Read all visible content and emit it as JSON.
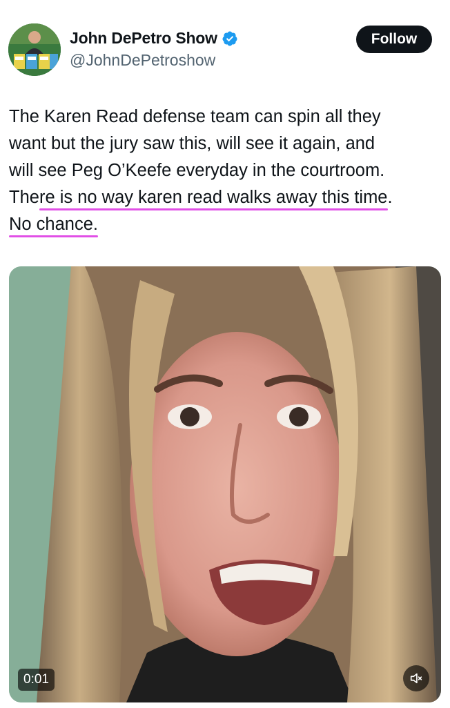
{
  "author": {
    "display_name": "John DePetro Show",
    "handle": "@JohnDePetroshow",
    "verified_icon": "verified-badge-icon",
    "avatar_icon": "avatar"
  },
  "follow_button": {
    "label": "Follow"
  },
  "tweet": {
    "line1": "The Karen Read defense team can spin all they",
    "line2": "want but the jury saw this, will see it again, and",
    "line3": "will see Peg O’Keefe everyday in the courtroom.",
    "line4_pre": "The",
    "line4_highlight": "re is no way karen read walks away this time",
    "line4_post": ".",
    "line5_highlight": "No chance."
  },
  "video": {
    "timestamp": "0:01",
    "mute_icon": "muted-speaker-icon"
  },
  "colors": {
    "accent_blue": "#1d9bf0",
    "highlight_underline": "#e14fe6",
    "follow_bg": "#0f1419",
    "handle_gray": "#536471"
  }
}
